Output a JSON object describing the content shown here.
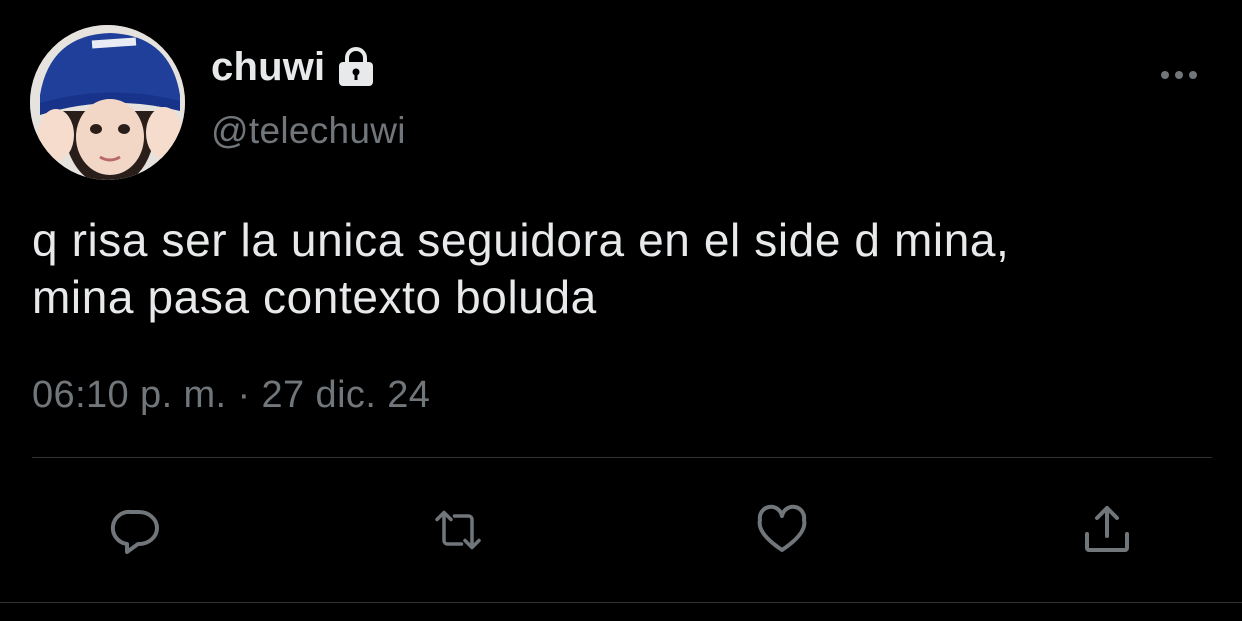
{
  "user": {
    "display_name": "chuwi",
    "handle": "@telechuwi",
    "protected": true
  },
  "tweet": {
    "text": "q risa ser la unica seguidora en el side d mina,\nmina pasa contexto boluda",
    "time": "06:10 p. m.",
    "separator": "·",
    "date": "27 dic. 24"
  },
  "icons": {
    "protected": "lock-icon",
    "more": "more-horizontal-icon",
    "reply": "reply-icon",
    "retweet": "retweet-icon",
    "like": "heart-icon",
    "share": "share-icon"
  },
  "colors": {
    "background": "#000000",
    "primary_text": "#e7e9ea",
    "secondary_text": "#71767b",
    "divider": "#2f3336",
    "icon": "#71767b"
  }
}
